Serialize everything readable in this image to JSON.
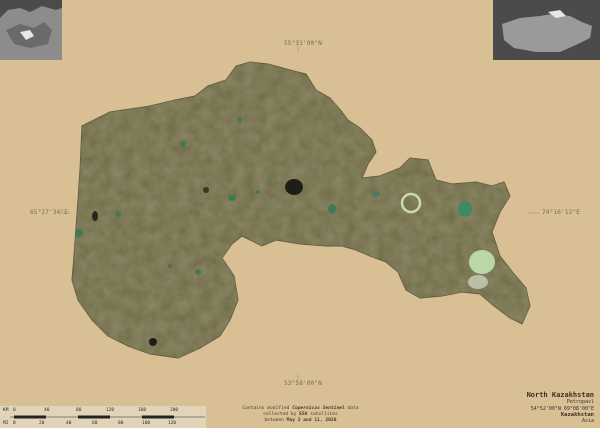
{
  "region": {
    "name": "North Kazakhstan",
    "capital": "Petropavl",
    "coordinates": "54°52'00\"N 69°08'00\"E",
    "country": "Kazakhstan",
    "continent": "Asia"
  },
  "graticule": {
    "top": "55°31'00\"N",
    "bottom": "53°58'00\"N",
    "left": "65°27'34\"E",
    "right": "74°16'12\"E"
  },
  "attribution": {
    "line1_prefix": "Contains modified ",
    "line1_emph": "Copernicus Sentinel",
    "line1_suffix": " data",
    "line2_prefix": "collected by ",
    "line2_emph": "ESA",
    "line2_suffix": " satellites",
    "line3_prefix": "between ",
    "line3_emph": "May 2 and 11, 2020"
  },
  "scale_bar": {
    "km_unit": "KM",
    "km_ticks": [
      "0",
      "40",
      "80",
      "120",
      "160",
      "200"
    ],
    "mi_unit": "MI",
    "mi_ticks": [
      "0",
      "20",
      "40",
      "60",
      "80",
      "100",
      "120"
    ]
  },
  "colors": {
    "background": "#d9bf94",
    "terrain": "#6f6a45",
    "lake_green": "#3f7a55",
    "salt_lake": "#b9d8a8",
    "inset_bg": "#4b4b4b",
    "inset_land": "#9a9a9a",
    "highlight": "#e8e8e8"
  }
}
